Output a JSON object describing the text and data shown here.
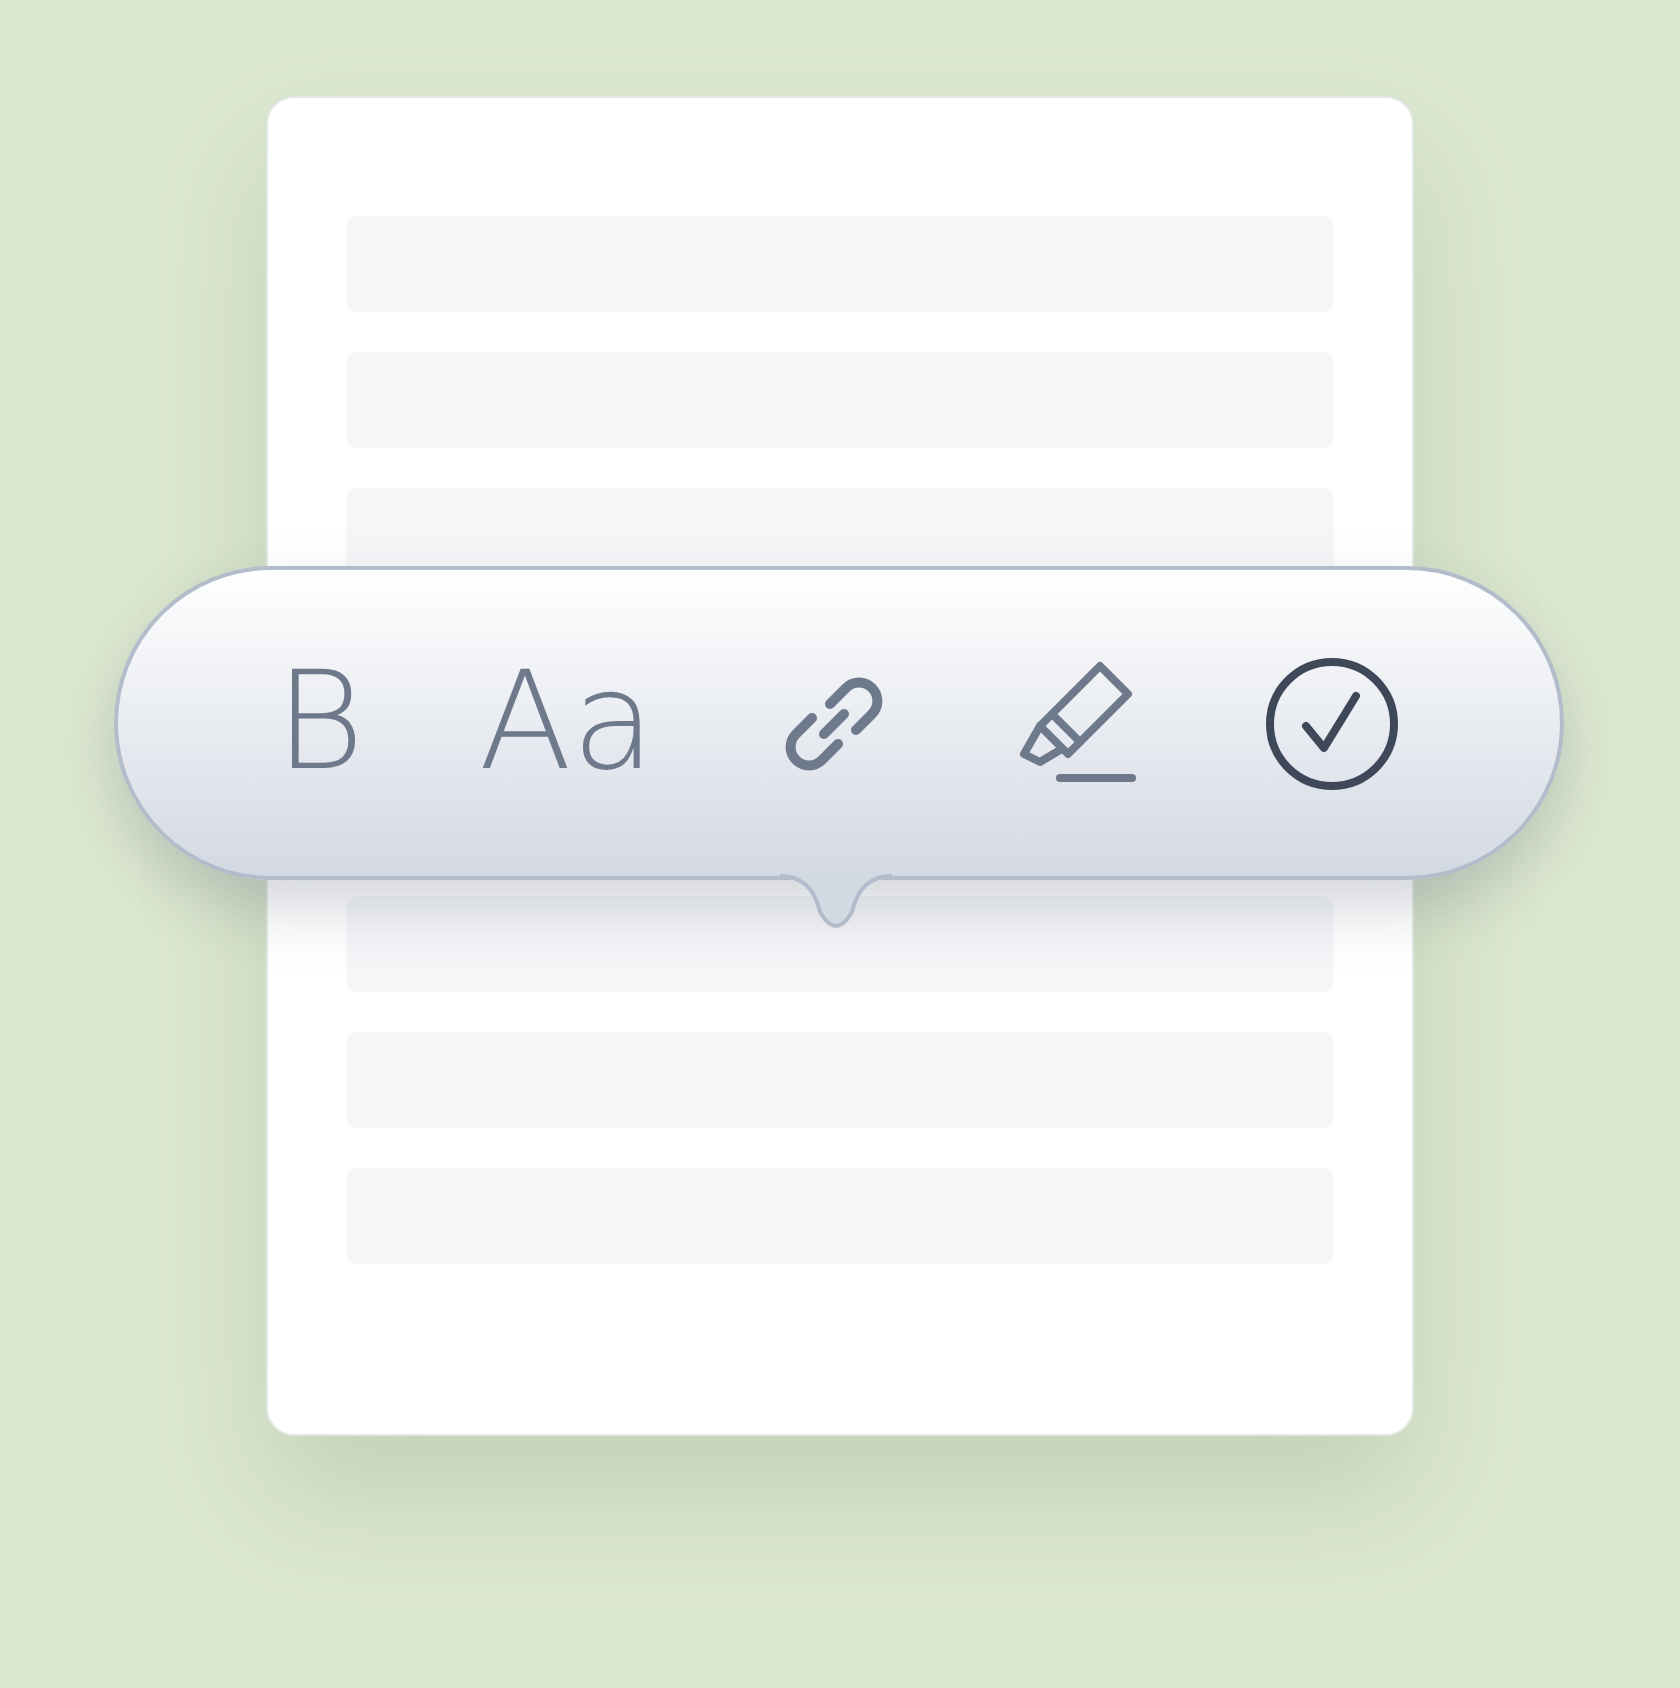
{
  "toolbar": {
    "items": [
      {
        "kind": "text",
        "label": "B"
      },
      {
        "kind": "text",
        "label": "Aa"
      },
      {
        "kind": "link"
      },
      {
        "kind": "highlighter"
      },
      {
        "kind": "confirm"
      }
    ]
  }
}
